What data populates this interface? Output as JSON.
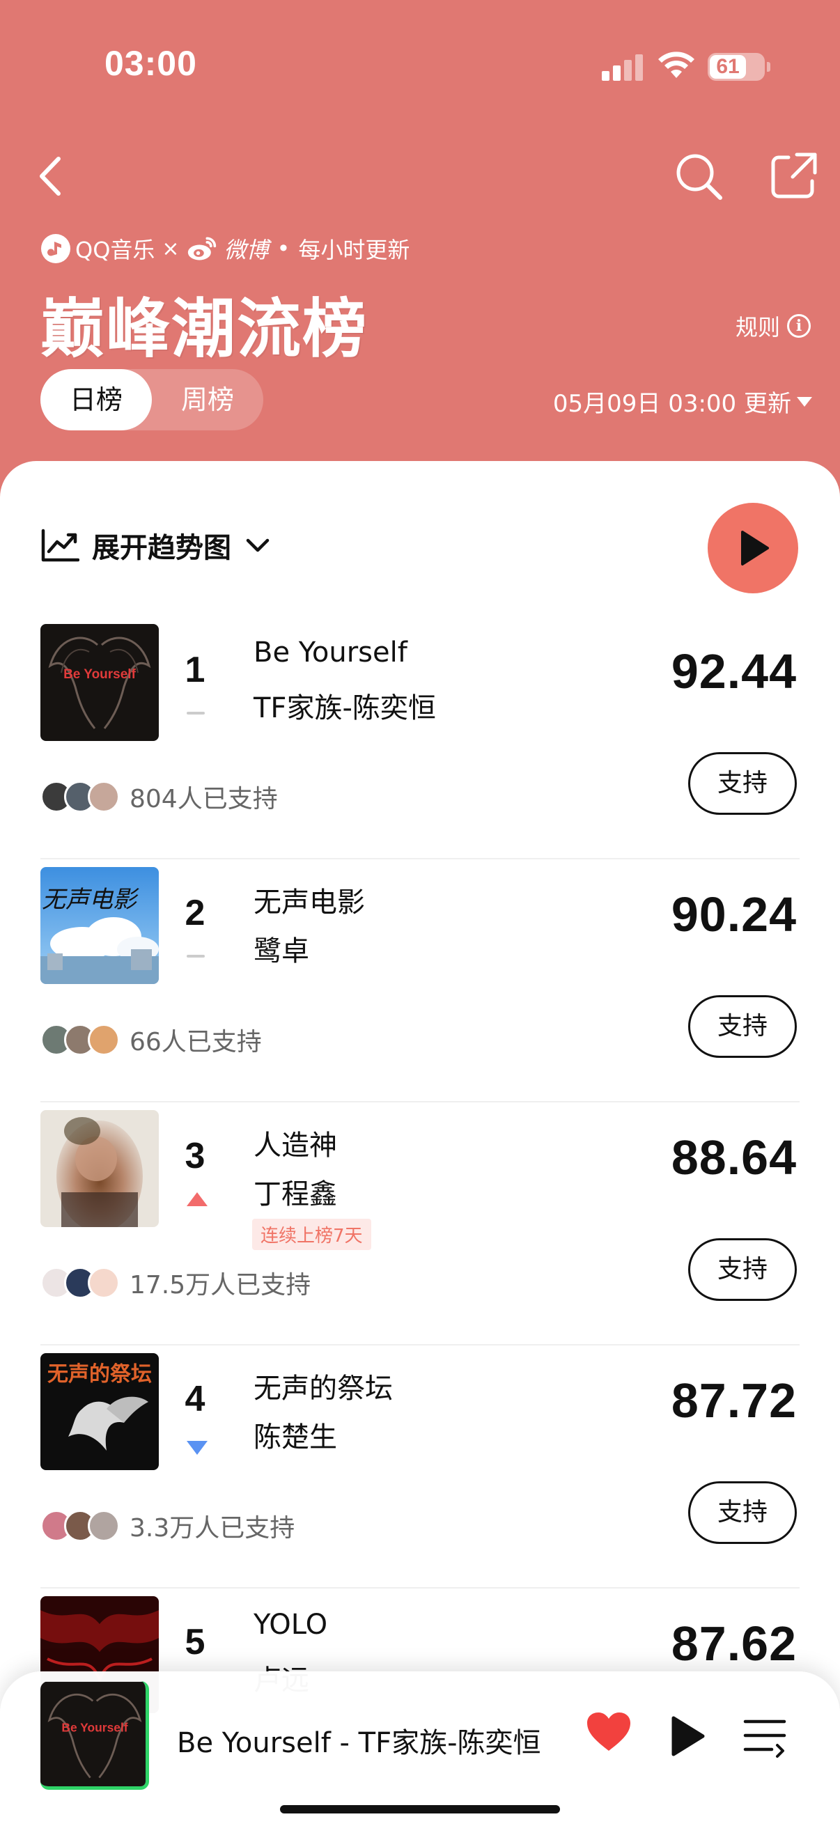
{
  "status_bar": {
    "time": "03:00",
    "battery": "61"
  },
  "header": {
    "brand_qq": "QQ音乐",
    "brand_times": "×",
    "brand_weibo": "微博",
    "brand_dot": "•",
    "update_freq": "每小时更新",
    "title": "巅峰潮流榜",
    "rules": "规则",
    "tabs": [
      {
        "label": "日榜",
        "active": true
      },
      {
        "label": "周榜",
        "active": false
      }
    ],
    "updated": "05月09日 03:00 更新"
  },
  "list": {
    "trend_toggle": "展开趋势图",
    "items": [
      {
        "rank": "1",
        "song": "Be Yourself",
        "artist": "TF家族-陈奕恒",
        "score": "92.44",
        "trend": "flat",
        "streak": "",
        "supporters": "804人已支持",
        "support_label": "支持",
        "cover_text": "Be Yourself"
      },
      {
        "rank": "2",
        "song": "无声电影",
        "artist": "鹭卓",
        "score": "90.24",
        "trend": "flat",
        "streak": "",
        "supporters": "66人已支持",
        "support_label": "支持",
        "cover_text": "无声电影"
      },
      {
        "rank": "3",
        "song": "人造神",
        "artist": "丁程鑫",
        "score": "88.64",
        "trend": "up",
        "streak": "连续上榜7天",
        "supporters": "17.5万人已支持",
        "support_label": "支持",
        "cover_text": ""
      },
      {
        "rank": "4",
        "song": "无声的祭坛",
        "artist": "陈楚生",
        "score": "87.72",
        "trend": "down",
        "streak": "",
        "supporters": "3.3万人已支持",
        "support_label": "支持",
        "cover_text": "无声的祭坛"
      },
      {
        "rank": "5",
        "song": "YOLO",
        "artist": "卢远",
        "score": "87.62",
        "trend": "",
        "streak": "",
        "supporters": "",
        "support_label": "",
        "cover_text": ""
      }
    ]
  },
  "player": {
    "now_playing": "Be Yourself - TF家族-陈奕恒",
    "cover_text": "Be Yourself"
  },
  "colors": {
    "header_bg": "#e07872",
    "accent": "#f07466",
    "up": "#f26b6b",
    "down": "#5a92f2"
  }
}
